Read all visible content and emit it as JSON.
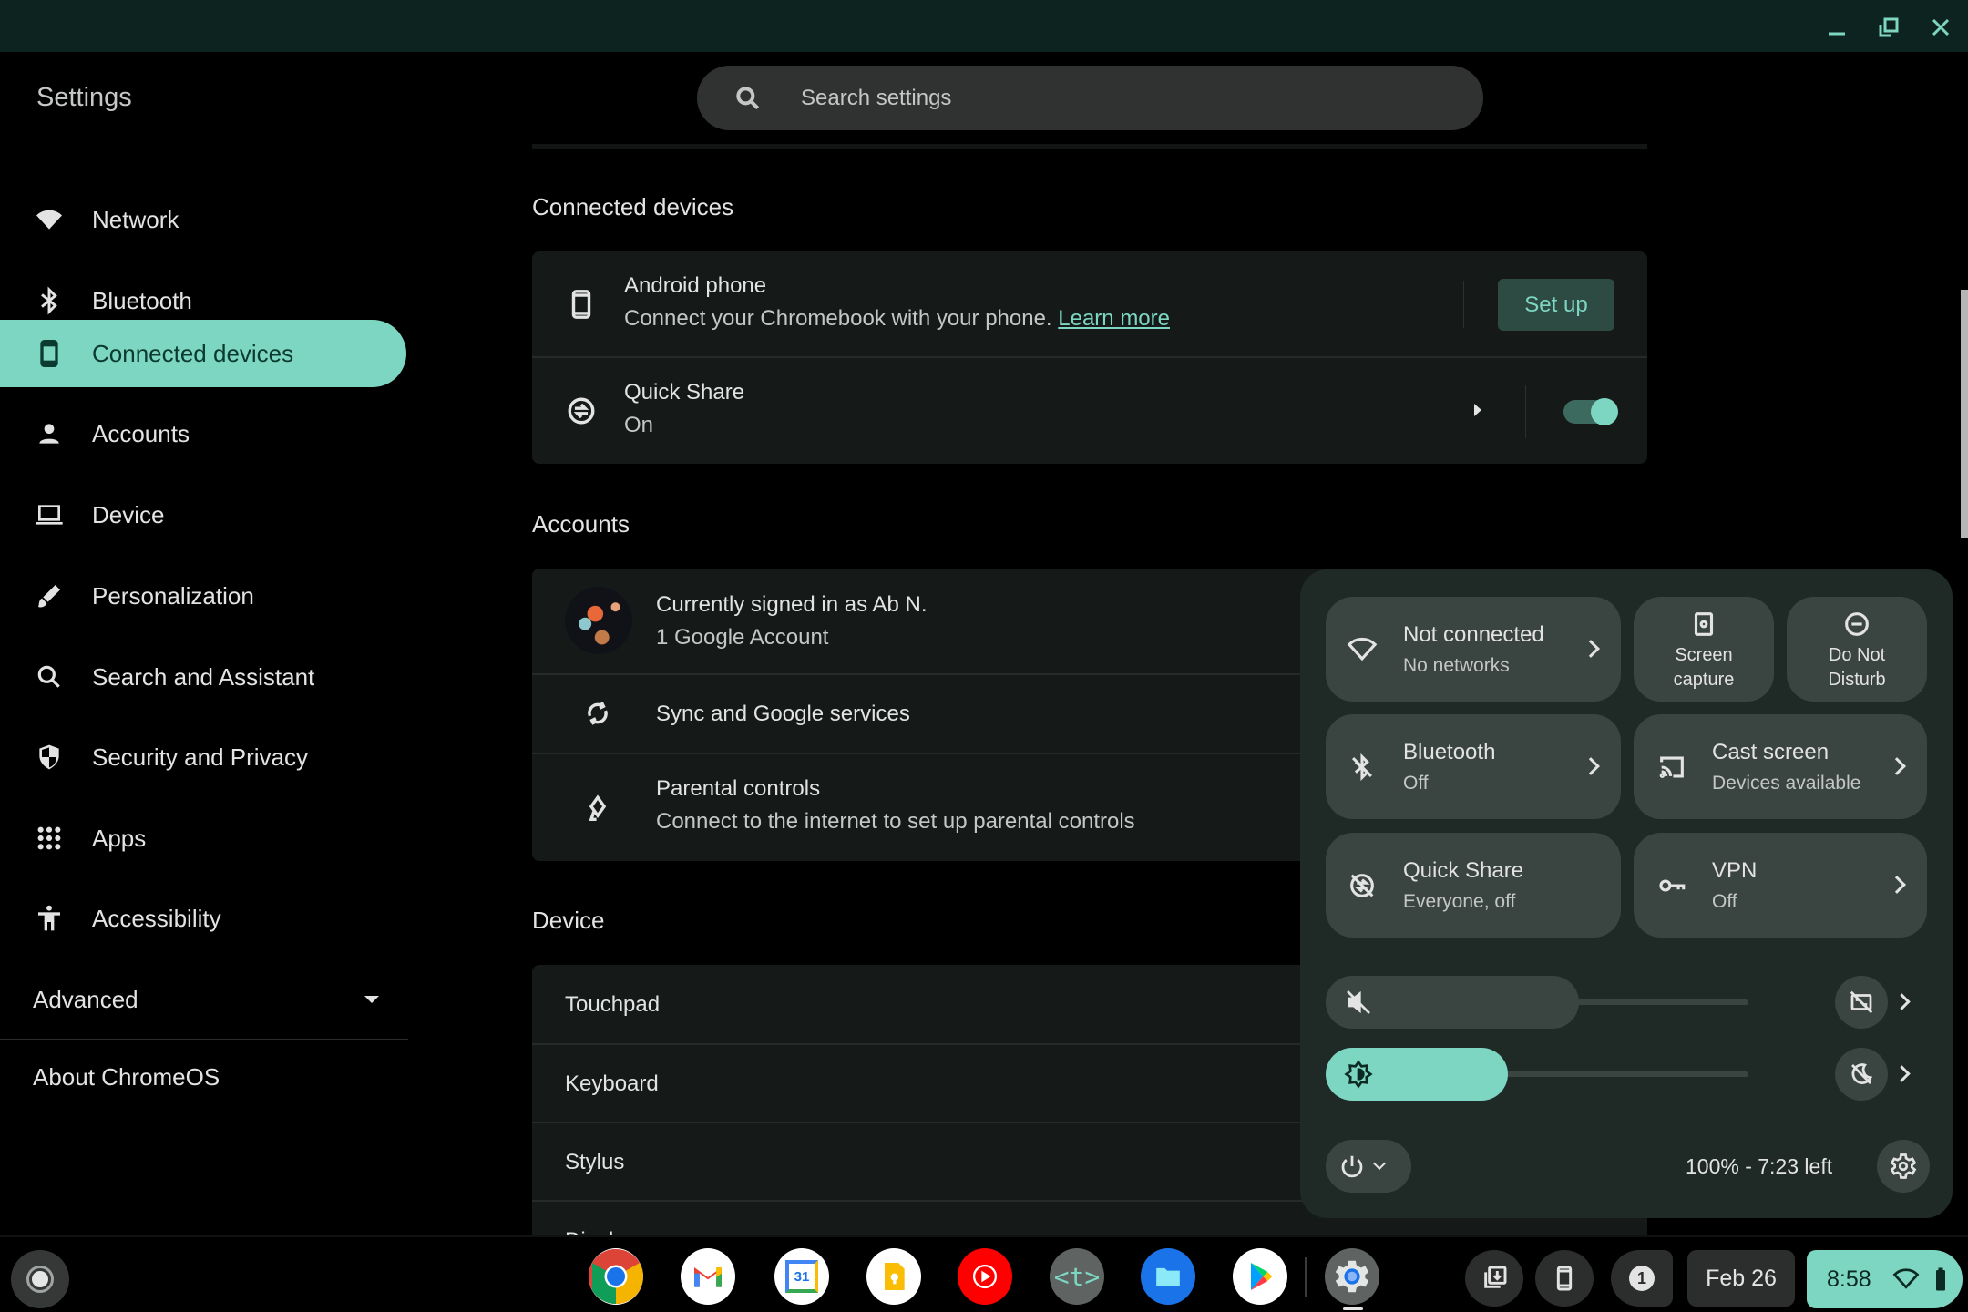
{
  "window": {
    "controls": [
      {
        "name": "minimize",
        "icon": "minimize-icon"
      },
      {
        "name": "restore",
        "icon": "restore-icon"
      },
      {
        "name": "close",
        "icon": "close-icon"
      }
    ]
  },
  "sidebar": {
    "title": "Settings",
    "items": [
      {
        "label": "Network",
        "icon": "wifi-icon",
        "active": false
      },
      {
        "label": "Bluetooth",
        "icon": "bluetooth-icon",
        "active": false
      },
      {
        "label": "Connected devices",
        "icon": "phone-icon",
        "active": true
      },
      {
        "label": "Accounts",
        "icon": "person-icon",
        "active": false
      },
      {
        "label": "Device",
        "icon": "laptop-icon",
        "active": false
      },
      {
        "label": "Personalization",
        "icon": "brush-icon",
        "active": false
      },
      {
        "label": "Search and Assistant",
        "icon": "search-icon",
        "active": false
      },
      {
        "label": "Security and Privacy",
        "icon": "shield-icon",
        "active": false
      },
      {
        "label": "Apps",
        "icon": "apps-grid-icon",
        "active": false
      },
      {
        "label": "Accessibility",
        "icon": "accessibility-icon",
        "active": false
      }
    ],
    "advanced_label": "Advanced",
    "about_label": "About ChromeOS"
  },
  "search": {
    "placeholder": "Search settings",
    "value": ""
  },
  "sections": {
    "connected_devices": {
      "title": "Connected devices",
      "android_phone": {
        "title": "Android phone",
        "subtitle": "Connect your Chromebook with your phone.",
        "link": "Learn more",
        "button": "Set up"
      },
      "quick_share": {
        "title": "Quick Share",
        "subtitle": "On",
        "toggle_on": true
      }
    },
    "accounts": {
      "title": "Accounts",
      "signed_in": "Currently signed in as Ab N.",
      "account_count": "1 Google Account",
      "sync": "Sync and Google services",
      "parental_title": "Parental controls",
      "parental_subtitle": "Connect to the internet to set up parental controls"
    },
    "device": {
      "title": "Device",
      "items": [
        "Touchpad",
        "Keyboard",
        "Stylus",
        "Display"
      ]
    }
  },
  "quick_settings": {
    "network": {
      "title": "Not connected",
      "subtitle": "No networks"
    },
    "screen_capture": {
      "line1": "Screen",
      "line2": "capture"
    },
    "dnd": {
      "line1": "Do Not",
      "line2": "Disturb"
    },
    "bluetooth": {
      "title": "Bluetooth",
      "subtitle": "Off"
    },
    "cast": {
      "title": "Cast screen",
      "subtitle": "Devices available"
    },
    "quick_share": {
      "title": "Quick Share",
      "subtitle": "Everyone, off"
    },
    "vpn": {
      "title": "VPN",
      "subtitle": "Off"
    },
    "volume": {
      "muted": true,
      "level_percent": 60
    },
    "brightness": {
      "level_percent": 43
    },
    "battery_text": "100% - 7:23 left",
    "accent": "#7dd6c1"
  },
  "shelf": {
    "apps": [
      {
        "name": "Chrome"
      },
      {
        "name": "Gmail"
      },
      {
        "name": "Calendar",
        "badge": "31"
      },
      {
        "name": "Keep"
      },
      {
        "name": "YouTube Music"
      },
      {
        "name": "Text",
        "badge": "<t>"
      },
      {
        "name": "Files"
      },
      {
        "name": "Play Store"
      },
      {
        "name": "Settings",
        "active": true
      }
    ],
    "notification_count": "1",
    "date": "Feb 26",
    "time": "8:58"
  }
}
